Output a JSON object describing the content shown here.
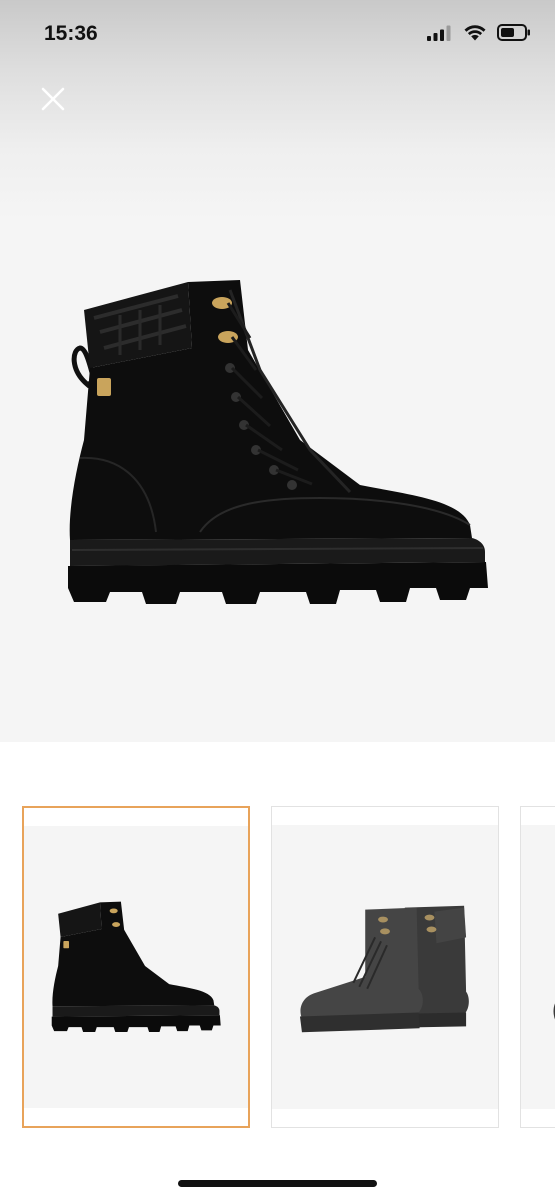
{
  "status_bar": {
    "time": "15:36",
    "signal_icon": "cellular-signal-icon",
    "wifi_icon": "wifi-icon",
    "battery_icon": "battery-icon"
  },
  "header": {
    "close_icon": "close-icon"
  },
  "gallery": {
    "main_image": "black-leather-lace-up-boot-side-view",
    "thumbnails": [
      {
        "image": "black-boot-side-view",
        "selected": true
      },
      {
        "image": "black-boot-pair-front-view",
        "selected": false
      },
      {
        "image": "black-boot-partial-view",
        "selected": false
      }
    ]
  },
  "colors": {
    "selection_border": "#e8a35a",
    "hero_background": "#f5f5f5"
  }
}
